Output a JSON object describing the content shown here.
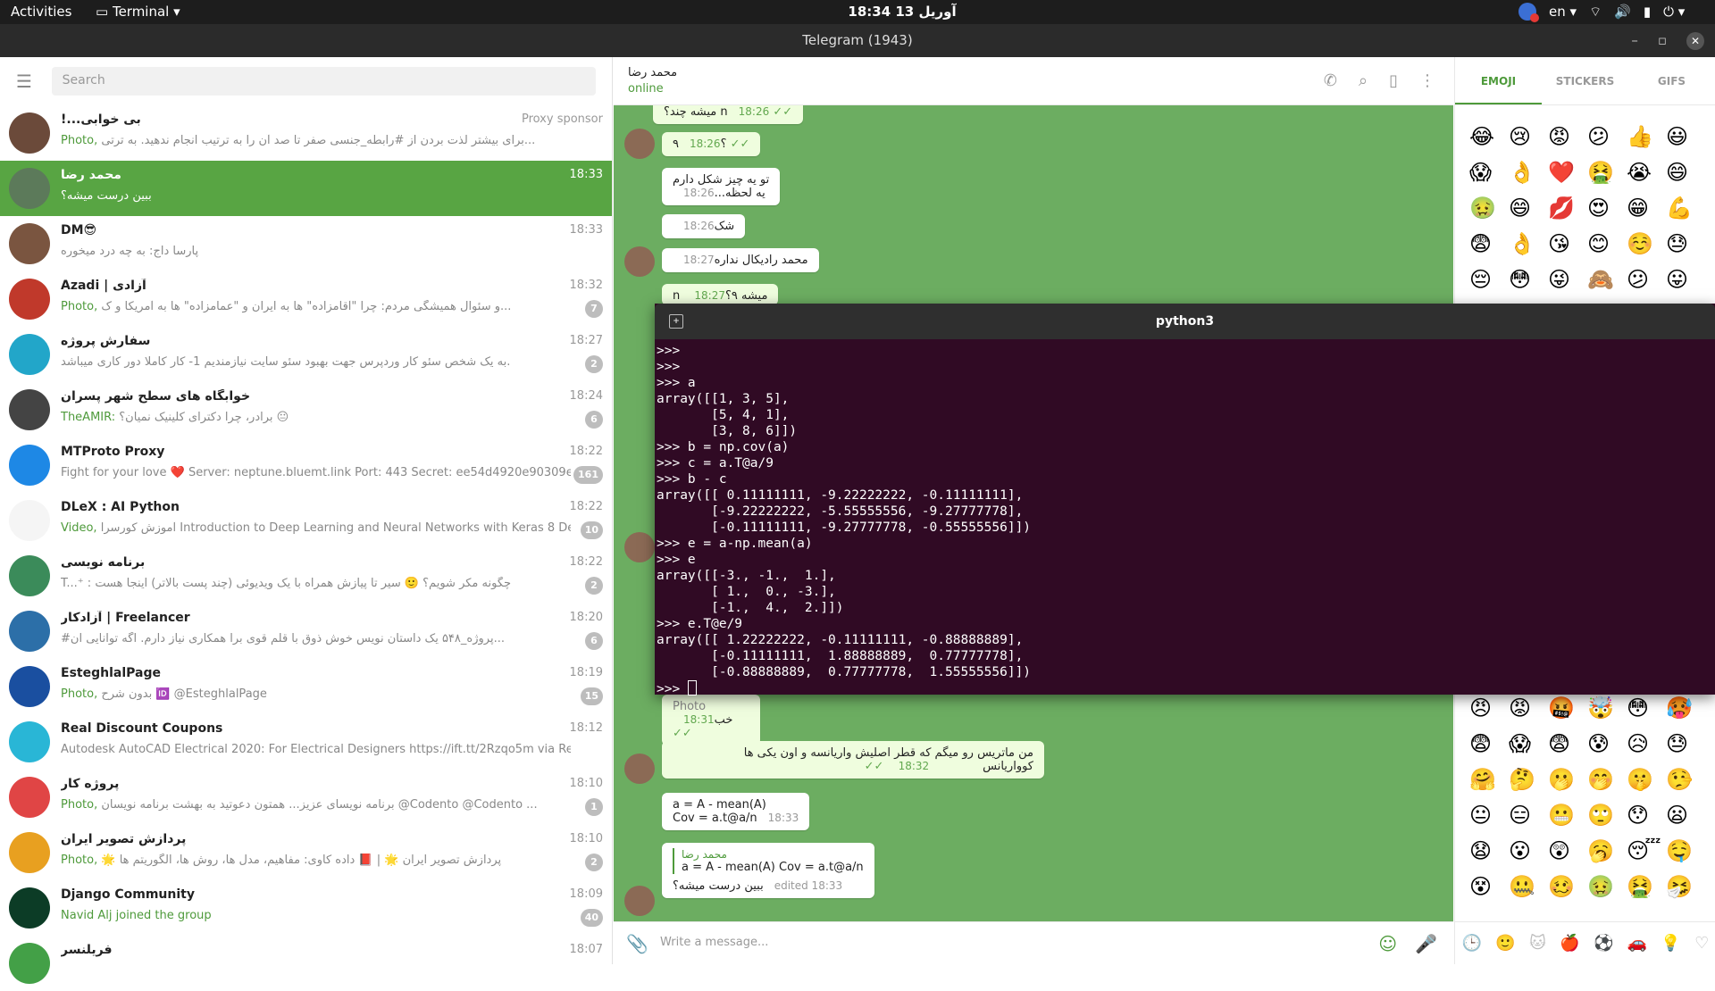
{
  "system": {
    "activities": "Activities",
    "app": "Terminal",
    "clock": "18:34  13 آوریل",
    "lang": "en"
  },
  "window": {
    "title": "Telegram (1943)"
  },
  "sidebar": {
    "search_placeholder": "Search",
    "chats": [
      {
        "name": "!...بی خوابی",
        "time": "",
        "sponsor": "Proxy sponsor",
        "prefix": "Photo,",
        "msg": "برای بیشتر لذت بردن از #رابطه_جنسی صفر تا صد آن را به ترتیب انجام ندهید. به ترتی...",
        "unread": "",
        "color": "#6b4a3a"
      },
      {
        "name": "محمد رضا",
        "time": "18:33",
        "prefix": "",
        "msg": "ببین درست میشه؟",
        "unread": "",
        "color": "#5c7a5a",
        "active": true
      },
      {
        "name": "DM😎",
        "time": "18:33",
        "prefix": "",
        "msg": "پارسا داج: به چه درد میخوره",
        "unread": "",
        "color": "#7a5540"
      },
      {
        "name": "Azadi | آزادی",
        "time": "18:32",
        "prefix": "Photo,",
        "msg": "و سئوال همیشگی مردم: چرا \"آقامزاده\" ها به ایران و \"عمامزاده\" ها به آمریکا و ک...",
        "unread": "7",
        "color": "#c0392b"
      },
      {
        "name": "سفارش پروژه",
        "time": "18:27",
        "prefix": "",
        "msg": "به یک شخص سئو کار وردپرس جهت بهبود سئو سایت نیازمندیم 1- کار کاملا دور کاری میباشد.",
        "unread": "2",
        "color": "#22a6c9"
      },
      {
        "name": "خوابگاه های سطح شهر پسران",
        "time": "18:24",
        "prefix": "TheAMIR:",
        "msg": "برادر، چرا دکترای کلینیک نمیان؟ 😐",
        "unread": "6",
        "color": "#444"
      },
      {
        "name": "MTProto Proxy",
        "time": "18:22",
        "prefix": "",
        "msg": "Fight for your love ❤️  Server: neptune.bluemt.link Port: 443 Secret: ee54d4920e90309e82da...",
        "unread": "161",
        "color": "#1e88e5"
      },
      {
        "name": "DLeX : AI Python",
        "time": "18:22",
        "prefix": "Video,",
        "msg": "آموزش کورسرا  Introduction to Deep Learning and Neural Networks with Keras  8 Dee...",
        "unread": "10",
        "color": "#f5f5f5"
      },
      {
        "name": "برنامه نویسی",
        "time": "18:22",
        "prefix": "",
        "msg": "T...⁺ : چگونه مکر شویم؟ 🙂 سیر تا پیازش همراه با یک ویدیوئی (چند پست بالاتر) اینجا هست",
        "unread": "2",
        "color": "#3b8b5a"
      },
      {
        "name": "آزادکار | Freelancer",
        "time": "18:20",
        "prefix": "",
        "msg": "#پروژه_۵۴۸ یک داستان نویس خوش ذوق با قلم قوی برا همکاری نیاز دارم. اگه توانایی ان...",
        "unread": "6",
        "color": "#2c6fa8"
      },
      {
        "name": "EsteghlalPage",
        "time": "18:19",
        "prefix": "Photo,",
        "msg": "بدون شرح 🆔 @EsteghlalPage",
        "unread": "15",
        "color": "#1a4fa0"
      },
      {
        "name": "Real Discount Coupons",
        "time": "18:12",
        "prefix": "",
        "msg": "Autodesk AutoCAD Electrical 2020: For Electrical Designers https://ift.tt/2Rzqo5m via Real Discount",
        "unread": "",
        "color": "#29b6d6"
      },
      {
        "name": "پروژه کار",
        "time": "18:10",
        "prefix": "Photo,",
        "msg": "برنامه نویسای عزیز... همتون دعوتید به بهشت برنامه نویسان @Codento @Codento ...",
        "unread": "1",
        "color": "#e04545"
      },
      {
        "name": "پردازش تصویر ایران",
        "time": "18:10",
        "prefix": "Photo,",
        "msg": "🌟 پردازش تصویر ایران 🌟 | 📕 داده کاوی: مفاهیم، مدل ها، روش ها، الگوریتم ها",
        "unread": "2",
        "color": "#e8a020"
      },
      {
        "name": "Django Community",
        "time": "18:09",
        "prefix": "Navid Alj joined the group",
        "msg": "",
        "unread": "40",
        "color": "#0c3c26"
      },
      {
        "name": "فریلنسر",
        "time": "18:07",
        "prefix": "",
        "msg": "",
        "unread": "",
        "color": "#43a047"
      }
    ]
  },
  "chat": {
    "name": "محمد رضا",
    "status": "online",
    "messages": [
      {
        "text": "میشه چند؟ n",
        "time": "18:26"
      },
      {
        "text": "؟۹",
        "time": "18:26"
      },
      {
        "text": "تو یه چیز شکل دارم",
        "text2": "یه لحظه...",
        "time": "18:26"
      },
      {
        "text": "شک",
        "time": "18:26"
      },
      {
        "text": "محمد رادیکال نداره",
        "time": "18:27"
      },
      {
        "text": "n میشه ۹؟",
        "time": "18:27"
      },
      {
        "text": "Photo",
        "time": ""
      },
      {
        "text": "خب",
        "time": "18:31"
      },
      {
        "text": "من ماتریس رو میگم که قطر اصلیش واریانسه و اون یکی ها",
        "text2": "کوواریانس",
        "time": "18:32"
      },
      {
        "text": "a = A - mean(A)",
        "text2": "Cov = a.t@a/n",
        "time": "18:33"
      },
      {
        "quote_name": "محمد رضا",
        "quote": "a = A - mean(A) Cov = a.t@a/n",
        "text": "ببین درست میشه؟",
        "time": "edited 18:33"
      }
    ],
    "composer_placeholder": "Write a message..."
  },
  "emoji_panel": {
    "tabs": [
      "EMOJI",
      "STICKERS",
      "GIFS"
    ],
    "top": [
      "😂",
      "😢",
      "😡",
      "😕",
      "👍",
      "😃",
      "😱",
      "👌",
      "❤️",
      "🤮",
      "😭",
      "😄",
      "🤢",
      "😄",
      "💋",
      "😍",
      "😁",
      "💪",
      "😨",
      "👌",
      "😘",
      "😊",
      "☺️",
      "😓",
      "😔",
      "😳",
      "😜",
      "🙈",
      "😕",
      "😛"
    ],
    "bottom": [
      "😠",
      "😡",
      "🤬",
      "🤯",
      "😳",
      "🥵",
      "😨",
      "😱",
      "😨",
      "😰",
      "😥",
      "😓",
      "🤗",
      "🤔",
      "🫢",
      "🤭",
      "🤫",
      "🤥",
      "😐",
      "😑",
      "😬",
      "🙄",
      "😯",
      "😦",
      "😧",
      "😮",
      "😲",
      "🥱",
      "😴",
      "🤤",
      "😵",
      "🤐",
      "🥴",
      "🤢",
      "🤮",
      "🤧"
    ],
    "cats": [
      "🕒",
      "🙂",
      "🐱",
      "🍎",
      "⚽",
      "🚗",
      "💡",
      "♡"
    ]
  },
  "terminal": {
    "title": "python3",
    "lines": [
      ">>> ",
      ">>> ",
      ">>> a",
      "array([[1, 3, 5],",
      "       [5, 4, 1],",
      "       [3, 8, 6]])",
      ">>> b = np.cov(a)",
      ">>> c = a.T@a/9",
      ">>> b - c",
      "array([[ 0.11111111, -9.22222222, -0.11111111],",
      "       [-9.22222222, -5.55555556, -9.27777778],",
      "       [-0.11111111, -9.27777778, -0.55555556]])",
      ">>> e = a-np.mean(a)",
      ">>> e",
      "array([[-3., -1.,  1.],",
      "       [ 1.,  0., -3.],",
      "       [-1.,  4.,  2.]])",
      ">>> e.T@e/9",
      "array([[ 1.22222222, -0.11111111, -0.88888889],",
      "       [-0.11111111,  1.88888889,  0.77777778],",
      "       [-0.88888889,  0.77777778,  1.55555556]])"
    ],
    "prompt": ">>> "
  }
}
